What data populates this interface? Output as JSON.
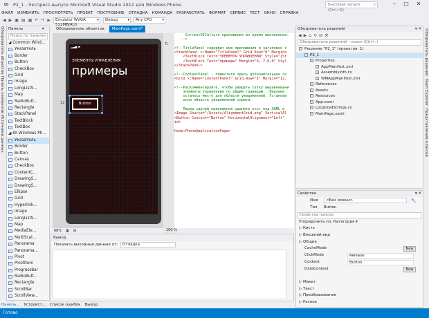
{
  "window": {
    "title": "P2_1 - Экспресс-выпуск Microsoft Visual Studio 2012 для Windows Phone",
    "quick_launch": "Быстрый запуск (Ctrl+Q)"
  },
  "menu": [
    "ФАЙЛ",
    "ИЗМЕНИТЬ",
    "ПРОСМОТРЕТЬ",
    "ПРОЕКТ",
    "ПОСТРОЕНИЕ",
    "ОТЛАДКА",
    "КОМАНДА",
    "РАЗРАБОТАТЬ",
    "ФОРМАТ",
    "СЕРВИС",
    "ТЕСТ",
    "ОКНО",
    "СПРАВКА"
  ],
  "toolbar": {
    "run_target": "Emulator WVGA 512MB(RU)",
    "config": "Debug",
    "platform": "Any CPU"
  },
  "left_tabs": [
    "Обозреватель объектов",
    "Панель элементов",
    "Источники данных"
  ],
  "toolbox": {
    "title": "Панель элементов",
    "search_placeholder": "Поиск по панели",
    "items": [
      {
        "label": "Common Wind...",
        "section": true
      },
      {
        "label": "Указатель"
      },
      {
        "label": "Border"
      },
      {
        "label": "Button"
      },
      {
        "label": "CheckBox"
      },
      {
        "label": "Grid"
      },
      {
        "label": "Image"
      },
      {
        "label": "LongListS..."
      },
      {
        "label": "Map"
      },
      {
        "label": "RadioButt..."
      },
      {
        "label": "Rectangle"
      },
      {
        "label": "StackPanel"
      },
      {
        "label": "TextBlock"
      },
      {
        "label": "TextBox"
      },
      {
        "label": "All Windows Ph...",
        "section": true
      },
      {
        "label": "Указатель",
        "selected": true
      },
      {
        "label": "Border"
      },
      {
        "label": "Button"
      },
      {
        "label": "Canvas"
      },
      {
        "label": "CheckBox"
      },
      {
        "label": "ContentC..."
      },
      {
        "label": "DrawingS..."
      },
      {
        "label": "DrawingS..."
      },
      {
        "label": "Ellipse"
      },
      {
        "label": "Grid"
      },
      {
        "label": "Hyperlink..."
      },
      {
        "label": "Image"
      },
      {
        "label": "LongListS..."
      },
      {
        "label": "Map"
      },
      {
        "label": "MediaEle..."
      },
      {
        "label": "MultiScal..."
      },
      {
        "label": "Panorama"
      },
      {
        "label": "Panorama..."
      },
      {
        "label": "Pivot"
      },
      {
        "label": "PivotItem"
      },
      {
        "label": "ProgressBar"
      },
      {
        "label": "RadioButt..."
      },
      {
        "label": "Rectangle"
      },
      {
        "label": "ScrollBar"
      },
      {
        "label": "ScrollView..."
      }
    ]
  },
  "doc_tabs": [
    "Обозреватель объектов",
    "MainPage.xaml*"
  ],
  "phone": {
    "app_title": "ЭЛЕМЕНТЫ УПРАВЛЕНИЯ",
    "page_title": "примеры",
    "button_label": "Button",
    "margin_label": "12"
  },
  "zoom": {
    "design": "68%",
    "xaml": "100 %"
  },
  "xaml_lines": [
    {
      "t": "     CurrentUICulture приложения во время выполнения.",
      "c": "g"
    },
    {
      "t": "   -->",
      "c": "g"
    },
    {
      "t": "",
      "c": "b"
    },
    {
      "t": "<!--TitlePanel содержит имя приложения и заголовок с",
      "c": "g"
    },
    {
      "t": "<StackPanel x:Name=\"TitlePanel\" Grid.Row=\"0\" Margin=",
      "c": "r"
    },
    {
      "t": "    <TextBlock Text=\"ЭЛЕМЕНТЫ УПРАВЛЕНИЯ\" Style=\"{St",
      "c": "r"
    },
    {
      "t": "    <TextBlock Text=\"примеры\" Margin=\"9,-7,0,0\" Styl",
      "c": "r"
    },
    {
      "t": "</StackPanel>",
      "c": "r"
    },
    {
      "t": "",
      "c": "b"
    },
    {
      "t": "<!--ContentPanel - поместите здесь дополнительное со",
      "c": "g"
    },
    {
      "t": "<Grid x:Name=\"ContentPanel\" Grid.Row=\"1\" Margin=\"12,",
      "c": "r"
    },
    {
      "t": "",
      "c": "b"
    },
    {
      "t": "<!--Раскомментируйте, чтобы увидеть сетку выравнивани",
      "c": "g"
    },
    {
      "t": "    элементы управления по общим границам.  Верхнее",
      "c": "g"
    },
    {
      "t": "    осталось место для области уведомлений. Установи",
      "c": "g"
    },
    {
      "t": "    если область уведомлений скрыта.",
      "c": "g"
    },
    {
      "t": "",
      "c": "b"
    },
    {
      "t": "    Перед сдачей приложения удалите этот код XAML и",
      "c": "g"
    },
    {
      "t": "<Image Source=\"/Assets/AlignmentGrid.png\" VerticalAl",
      "c": "r"
    },
    {
      "t": "<Button Content=\"Button\" HorizontalAlignment=\"Left\"",
      "c": "r"
    },
    {
      "t": "id>",
      "c": "r"
    },
    {
      "t": "",
      "c": "b"
    },
    {
      "t": "hone:PhoneApplicationPage>",
      "c": "r"
    }
  ],
  "output": {
    "title": "Вывод",
    "show_from_label": "Показать выходные данные от:",
    "source": "Отладка"
  },
  "bottom_tabs": [
    "Панель...",
    "Устройст...",
    "Список ошибок",
    "Вывод"
  ],
  "status": "Готово",
  "solution": {
    "title": "Обозреватель решений",
    "search_placeholder": "Обозреватель решений - поиск (Ctrl+;)",
    "items": [
      {
        "label": "Решение \"P2_1\" (проектов: 1)",
        "indent": 0
      },
      {
        "label": "P2_1",
        "indent": 1,
        "selected": true
      },
      {
        "label": "Properties",
        "indent": 2
      },
      {
        "label": "AppManifest.xml",
        "indent": 3
      },
      {
        "label": "AssemblyInfo.cs",
        "indent": 3
      },
      {
        "label": "WMAppManifest.xml",
        "indent": 3
      },
      {
        "label": "References",
        "indent": 2
      },
      {
        "label": "Assets",
        "indent": 2
      },
      {
        "label": "Resources",
        "indent": 2
      },
      {
        "label": "App.xaml",
        "indent": 2
      },
      {
        "label": "LocalizedStrings.cs",
        "indent": 2
      },
      {
        "label": "MainPage.xaml",
        "indent": 2
      }
    ]
  },
  "right_tabs": [
    "Обозреватель решений",
    "Team Explorer",
    "Представление классов"
  ],
  "properties": {
    "title": "Свойства",
    "name_label": "Имя",
    "name_value": "<Без имени>",
    "type_label": "Тип",
    "type_value": "Button",
    "search_placeholder": "Свойства поиска",
    "sort_label": "Упорядочить по: Категория ▾",
    "rows": [
      {
        "label": "Кисть",
        "cat": true
      },
      {
        "label": "Внешний вид",
        "cat": true
      },
      {
        "label": "Общие",
        "cat": true
      },
      {
        "label": "CacheMode",
        "value": "",
        "button": "New"
      },
      {
        "label": "ClickMode",
        "value": "Release"
      },
      {
        "label": "Content",
        "value": "Button"
      },
      {
        "label": "DataContext",
        "value": "",
        "button": "New"
      },
      {
        "label": "",
        "value": ""
      },
      {
        "label": "Макет",
        "cat": true
      },
      {
        "label": "Текст",
        "cat": true
      },
      {
        "label": "Преобразование",
        "cat": true
      },
      {
        "label": "Разное",
        "cat": true
      }
    ]
  }
}
